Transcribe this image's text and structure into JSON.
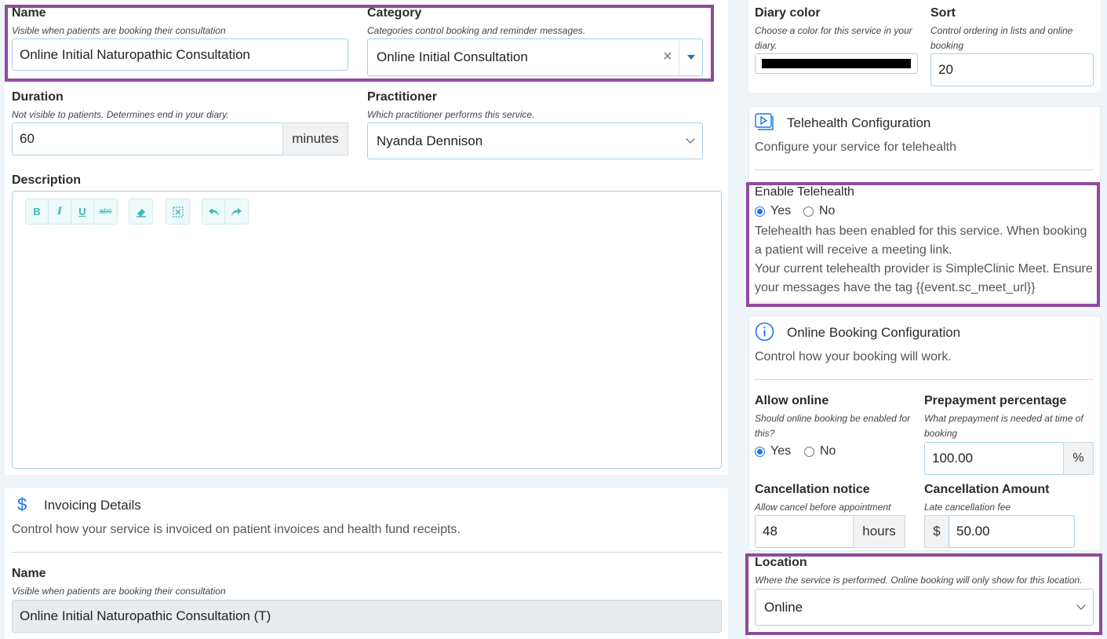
{
  "service": {
    "name_label": "Name",
    "name_hint": "Visible when patients are booking their consultation",
    "name_value": "Online Initial Naturopathic Consultation",
    "category_label": "Category",
    "category_hint": "Categories control booking and reminder messages.",
    "category_value": "Online Initial Consultation",
    "duration_label": "Duration",
    "duration_hint": "Not visible to patients. Determines end in your diary.",
    "duration_value": "60",
    "duration_unit": "minutes",
    "practitioner_label": "Practitioner",
    "practitioner_hint": "Which practitioner performs this service.",
    "practitioner_value": "Nyanda Dennison",
    "description_label": "Description"
  },
  "toolbar": {
    "bold": "B",
    "italic": "I",
    "underline": "U",
    "strike": "abc"
  },
  "invoicing": {
    "icon": "dollar-icon",
    "icon_glyph": "$",
    "title": "Invoicing Details",
    "subtitle": "Control how your service is invoiced on patient invoices and health fund receipts.",
    "name_label": "Name",
    "name_hint": "Visible when patients are booking their consultation",
    "name_value": "Online Initial Naturopathic Consultation (T)"
  },
  "diary": {
    "color_label": "Diary color",
    "color_hint": "Choose a color for this service in your diary.",
    "color_value": "#000000",
    "sort_label": "Sort",
    "sort_hint": "Control ordering in lists and online booking",
    "sort_value": "20"
  },
  "telehealth": {
    "title": "Telehealth Configuration",
    "subtitle": "Configure your service for telehealth",
    "enable_label": "Enable Telehealth",
    "yes": "Yes",
    "no": "No",
    "selected": "Yes",
    "info1": "Telehealth has been enabled for this service. When booking a patient will receive a meeting link.",
    "info2": "Your current telehealth provider is SimpleClinic Meet. Ensure your messages have the tag {{event.sc_meet_url}}"
  },
  "online_booking": {
    "title": "Online Booking Configuration",
    "subtitle": "Control how your booking will work.",
    "allow_label": "Allow online",
    "allow_hint": "Should online booking be enabled for this?",
    "yes": "Yes",
    "no": "No",
    "selected": "Yes",
    "prepay_label": "Prepayment percentage",
    "prepay_hint": "What prepayment is needed at time of booking",
    "prepay_value": "100.00",
    "prepay_unit": "%",
    "cancel_notice_label": "Cancellation notice",
    "cancel_notice_hint": "Allow cancel before appointment",
    "cancel_notice_value": "48",
    "cancel_notice_unit": "hours",
    "cancel_amount_label": "Cancellation Amount",
    "cancel_amount_hint": "Late cancellation fee",
    "cancel_amount_prefix": "$",
    "cancel_amount_value": "50.00"
  },
  "location": {
    "label": "Location",
    "hint": "Where the service is performed. Online booking will only show for this location.",
    "value": "Online"
  },
  "colors": {
    "highlight": "#8e4a9c",
    "accent": "#1a73e8",
    "editor_icons": "#3fb9b3"
  }
}
